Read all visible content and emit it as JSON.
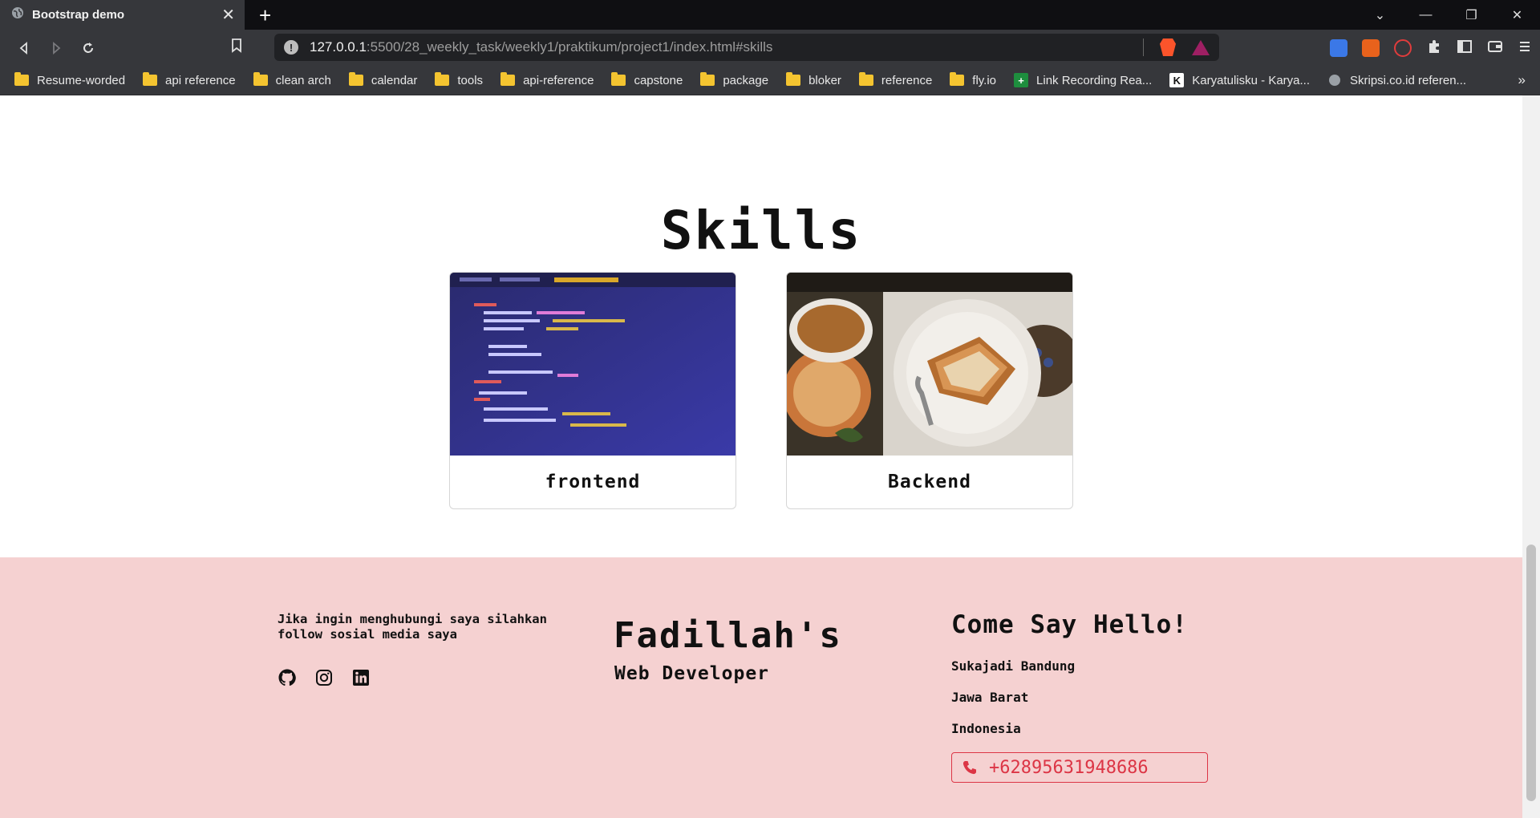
{
  "browser": {
    "tab_title": "Bootstrap demo",
    "tab_close": "✕",
    "new_tab": "+",
    "url_host": "127.0.0.1",
    "url_path": ":5500/28_weekly_task/weekly1/praktikum/project1/index.html#skills",
    "window_controls": [
      "⌄",
      "—",
      "❐",
      "✕"
    ]
  },
  "bookmarks": [
    {
      "label": "Resume-worded",
      "icon": "folder-icon"
    },
    {
      "label": "api reference",
      "icon": "folder-icon"
    },
    {
      "label": "clean arch",
      "icon": "folder-icon"
    },
    {
      "label": "calendar",
      "icon": "folder-icon"
    },
    {
      "label": "tools",
      "icon": "folder-icon"
    },
    {
      "label": "api-reference",
      "icon": "folder-icon"
    },
    {
      "label": "capstone",
      "icon": "folder-icon"
    },
    {
      "label": "package",
      "icon": "folder-icon"
    },
    {
      "label": "bloker",
      "icon": "folder-icon"
    },
    {
      "label": "reference",
      "icon": "folder-icon"
    },
    {
      "label": "fly.io",
      "icon": "folder-icon"
    },
    {
      "label": "Link Recording Rea...",
      "icon": "sheets-icon"
    },
    {
      "label": "Karyatulisku - Karya...",
      "icon": "k-icon"
    },
    {
      "label": "Skripsi.co.id referen...",
      "icon": "globe-icon"
    }
  ],
  "bookmarks_more": "»",
  "skills": {
    "title": "Skills",
    "cards": [
      {
        "label": "frontend"
      },
      {
        "label": "Backend"
      }
    ]
  },
  "footer": {
    "contact_text": "Jika ingin menghubungi saya silahkan follow sosial media saya",
    "brand": "Fadillah's",
    "role": "Web Developer",
    "hello": "Come Say Hello!",
    "address": [
      "Sukajadi Bandung",
      "Jawa Barat",
      "Indonesia"
    ],
    "phone": "+62895631948686"
  },
  "colors": {
    "footer_bg": "#f5d1d1",
    "phone_accent": "#dc3545"
  }
}
